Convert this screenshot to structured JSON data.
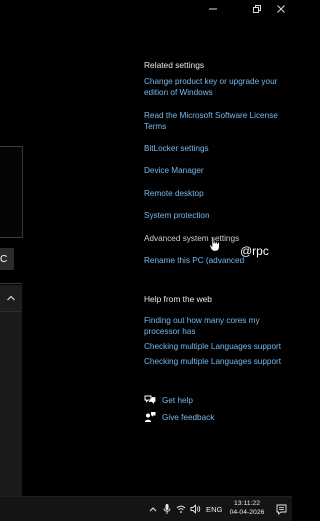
{
  "window": {
    "minimize_icon": "minimize-icon",
    "restore_icon": "restore-icon",
    "close_icon": "close-icon"
  },
  "left_panel": {
    "chip_text": "C"
  },
  "related_settings": {
    "heading": "Related settings",
    "links": [
      "Change product key or upgrade your edition of Windows",
      "Read the Microsoft Software License Terms",
      "BitLocker settings",
      "Device Manager",
      "Remote desktop",
      "System protection",
      "Advanced system settings",
      "Rename this PC (advanced)"
    ]
  },
  "help_from_web": {
    "heading": "Help from the web",
    "links": [
      "Finding out how many cores my processor has",
      "Checking multiple Languages support",
      "Checking multiple Languages support"
    ]
  },
  "support": {
    "get_help": "Get help",
    "give_feedback": "Give feedback"
  },
  "watermark": "@rpc",
  "taskbar": {
    "language": "ENG",
    "time": "13:11:22",
    "date": "04-04-2026"
  },
  "colors": {
    "link": "#76b9ed",
    "background": "#000000",
    "taskbar": "#141414"
  }
}
